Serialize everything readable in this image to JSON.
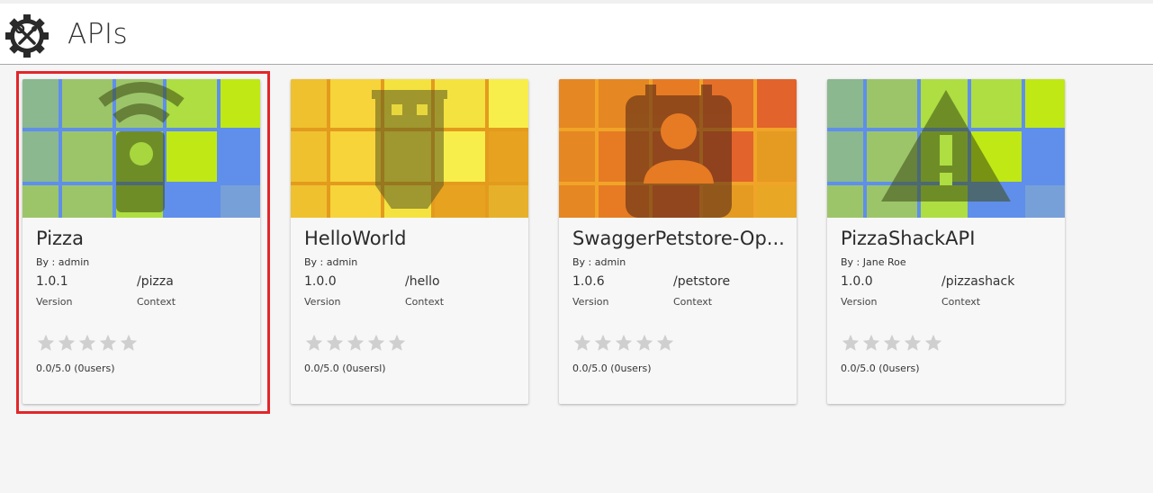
{
  "header": {
    "title": "APIs",
    "logo_icon": "gear-tools-icon"
  },
  "rating_star_color": "#cfcfcf",
  "highlight_color": "#e3262a",
  "cards": [
    {
      "name": "Pizza",
      "by": "By : admin",
      "version": "1.0.1",
      "version_label": "Version",
      "context": "/pizza",
      "context_label": "Context",
      "rating": "0.0/5.0 (0users)",
      "thumbnail_icon": "wifi-device-icon",
      "palette": [
        "#8bb88f",
        "#9cc56a",
        "#aede42",
        "#c0e815",
        "#5f8fea",
        "#77a0d8"
      ]
    },
    {
      "name": "HelloWorld",
      "by": "By : admin",
      "version": "1.0.0",
      "version_label": "Version",
      "context": "/hello",
      "context_label": "Context",
      "rating": "0.0/5.0 (0usersl)",
      "thumbnail_icon": "usb-icon",
      "palette": [
        "#efc12e",
        "#f6d43a",
        "#f4e240",
        "#f7ee4b",
        "#e7a320",
        "#e6b02b"
      ]
    },
    {
      "name": "SwaggerPetstore-Op...",
      "by": "By : admin",
      "version": "1.0.6",
      "version_label": "Version",
      "context": "/petstore",
      "context_label": "Context",
      "rating": "0.0/5.0 (0users)",
      "thumbnail_icon": "contact-card-icon",
      "palette": [
        "#e58722",
        "#e67b24",
        "#e46f28",
        "#e2632b",
        "#e59a22",
        "#e8a724"
      ]
    },
    {
      "name": "PizzaShackAPI",
      "by": "By : Jane Roe",
      "version": "1.0.0",
      "version_label": "Version",
      "context": "/pizzashack",
      "context_label": "Context",
      "rating": "0.0/5.0 (0users)",
      "thumbnail_icon": "warning-icon",
      "palette": [
        "#8bb88f",
        "#9cc56a",
        "#aede42",
        "#c0e815",
        "#5f8fea",
        "#77a0d8"
      ]
    }
  ]
}
